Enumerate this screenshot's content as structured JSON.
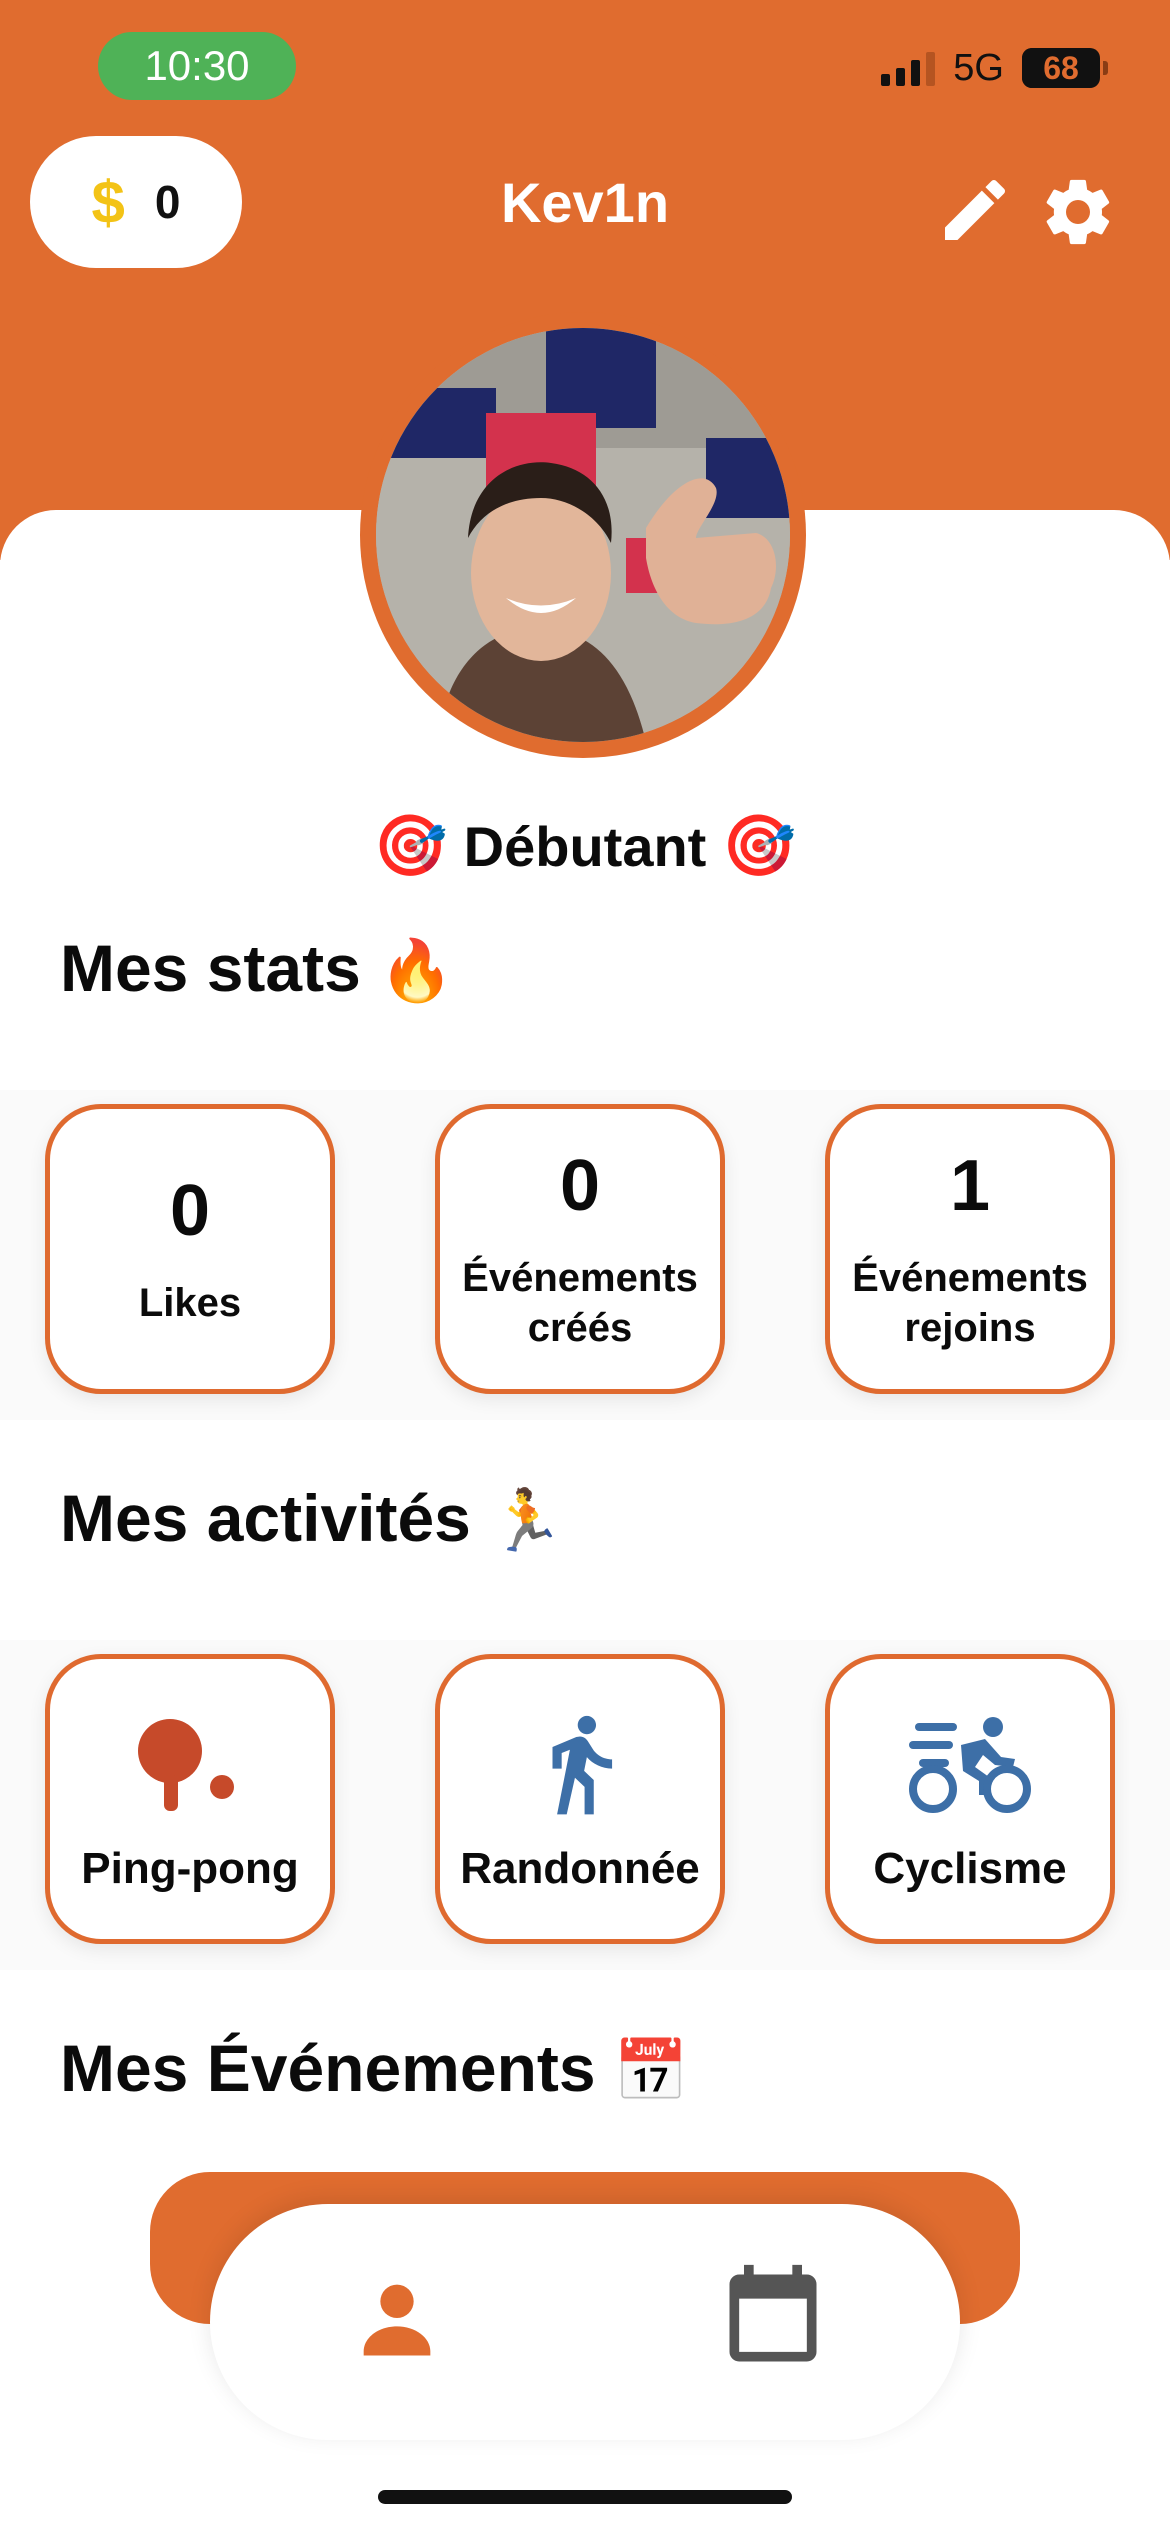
{
  "status_bar": {
    "time": "10:30",
    "network": "5G",
    "battery": "68"
  },
  "header": {
    "coins": "0",
    "coin_symbol": "$",
    "username": "Kev1n",
    "edit_icon": "pencil-icon",
    "settings_icon": "gear-icon"
  },
  "profile": {
    "level_emoji_left": "🎯",
    "level": "Débutant",
    "level_emoji_right": "🎯"
  },
  "stats": {
    "title": "Mes stats",
    "emoji": "🔥",
    "cards": [
      {
        "value": "0",
        "label": "Likes"
      },
      {
        "value": "0",
        "label_line1": "Événements",
        "label_line2": "créés"
      },
      {
        "value": "1",
        "label_line1": "Événements",
        "label_line2": "rejoins"
      }
    ]
  },
  "activities": {
    "title": "Mes activités",
    "emoji": "🏃",
    "items": [
      {
        "label": "Ping-pong",
        "icon": "ping-pong-icon"
      },
      {
        "label": "Randonnée",
        "icon": "hiking-icon"
      },
      {
        "label": "Cyclisme",
        "icon": "cycling-icon"
      }
    ]
  },
  "events": {
    "title": "Mes Événements",
    "emoji": "📅"
  },
  "bottom_nav": {
    "items": [
      {
        "icon": "profile-icon",
        "active": true
      },
      {
        "icon": "calendar-icon",
        "active": false
      }
    ]
  },
  "colors": {
    "accent": "#e06c2f",
    "coin": "#f3c316",
    "activity_blue": "#3d6fa7",
    "ping_pong_red": "#c64a2a"
  }
}
